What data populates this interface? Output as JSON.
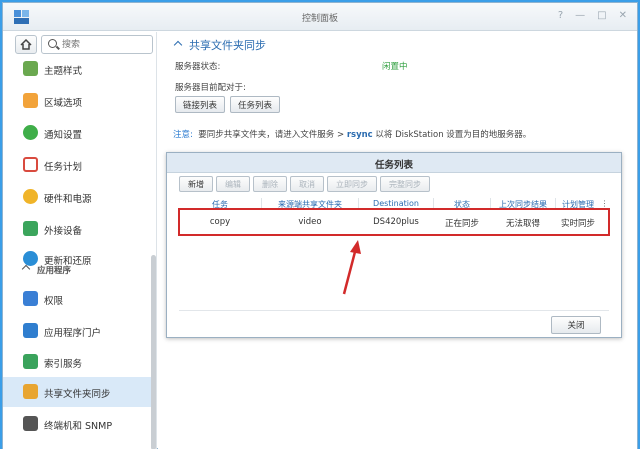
{
  "window": {
    "title": "控制面板",
    "controls": [
      "?",
      "—",
      "□",
      "✕"
    ]
  },
  "sidebar": {
    "search_placeholder": "搜索",
    "items": [
      {
        "label": "主题样式",
        "icon": "theme-icon",
        "color": "#6aa84f"
      },
      {
        "label": "区域选项",
        "icon": "calendar-icon",
        "color": "#f2a33a"
      },
      {
        "label": "通知设置",
        "icon": "chat-icon",
        "color": "#3fae49"
      },
      {
        "label": "任务计划",
        "icon": "checklist-icon",
        "color": "#d94b3f"
      },
      {
        "label": "硬件和电源",
        "icon": "bulb-icon",
        "color": "#f0b429"
      },
      {
        "label": "外接设备",
        "icon": "upload-icon",
        "color": "#3ba55c"
      },
      {
        "label": "更新和还原",
        "icon": "refresh-icon",
        "color": "#2a8ed6"
      }
    ],
    "section_label": "应用程序",
    "app_items": [
      {
        "label": "权限",
        "icon": "grid-icon",
        "color": "#3a7fd5"
      },
      {
        "label": "应用程序门户",
        "icon": "portal-icon",
        "color": "#2f7ecf"
      },
      {
        "label": "索引服务",
        "icon": "index-search-icon",
        "color": "#3aa35c"
      },
      {
        "label": "共享文件夹同步",
        "icon": "folder-sync-icon",
        "color": "#e8a531"
      },
      {
        "label": "终端机和 SNMP",
        "icon": "terminal-icon",
        "color": "#555"
      }
    ]
  },
  "main": {
    "title": "共享文件夹同步",
    "server_status_label": "服务器状态:",
    "server_status_value": "闲置中",
    "paired_label": "服务器目前配对于:",
    "link_list_button": "链接列表",
    "task_list_button": "任务列表",
    "note_label": "注意:",
    "note_text_1": "要同步共享文件夹，请进入文件服务 >",
    "note_rsync": "rsync",
    "note_text_2": "以将 DiskStation 设置为目的地服务器。"
  },
  "dialog": {
    "title": "任务列表",
    "toolbar": [
      "新增",
      "编辑",
      "删除",
      "取消",
      "立即同步",
      "完整同步"
    ],
    "columns": [
      "任务",
      "来源端共享文件夹",
      "Destination",
      "状态",
      "上次同步结果",
      "计划管理"
    ],
    "rows": [
      {
        "task": "copy",
        "source": "video",
        "destination": "DS420plus",
        "status": "正在同步",
        "last_result": "无法取得",
        "schedule": "实时同步"
      }
    ],
    "close_button": "关闭"
  },
  "annotation_color": "#d22a2a"
}
